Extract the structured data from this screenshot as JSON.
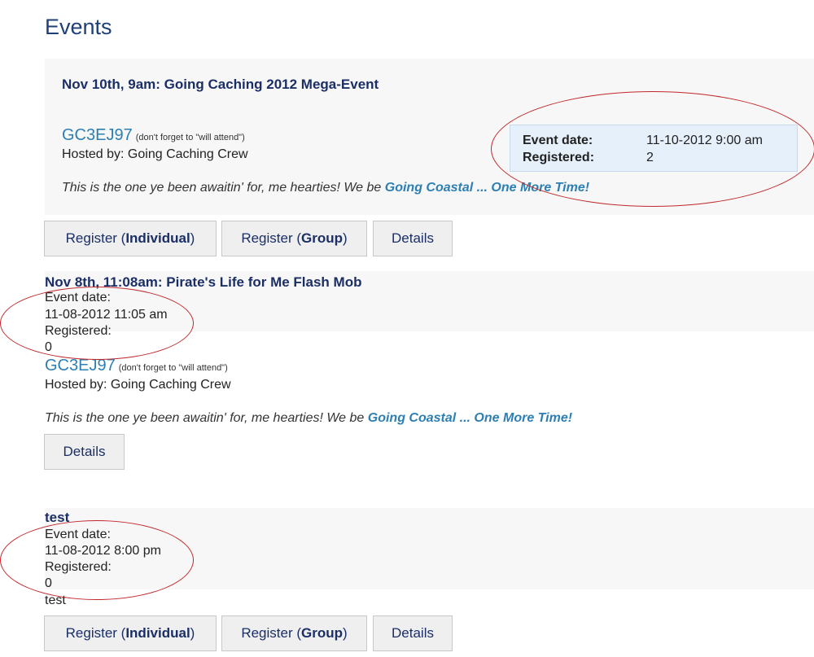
{
  "page": {
    "title": "Events"
  },
  "events": [
    {
      "title": "Nov 10th, 9am: Going Caching 2012 Mega-Event",
      "gc_code": "GC3EJ97",
      "gc_note": "(don't forget to \"will attend\")",
      "hosted_by": "Hosted by: Going Caching Crew",
      "description_prefix": "This is the one ye been awaitin' for, me hearties! We be ",
      "description_link": "Going Coastal ... One More Time!",
      "event_date_label": "Event date:",
      "event_date_value": "11-10-2012 9:00 am",
      "registered_label": "Registered:",
      "registered_value": "2",
      "buttons": {
        "register_individual_prefix": "Register (",
        "register_individual_bold": "Individual",
        "register_individual_suffix": ")",
        "register_group_prefix": "Register (",
        "register_group_bold": "Group",
        "register_group_suffix": ")",
        "details": "Details"
      }
    },
    {
      "title": "Nov 8th, 11:08am: Pirate's Life for Me Flash Mob",
      "event_date_label": "Event date:",
      "event_date_value": "11-08-2012 11:05 am",
      "registered_label": "Registered:",
      "registered_value": "0",
      "gc_code": "GC3EJ97",
      "gc_note": "(don't forget to \"will attend\")",
      "hosted_by": "Hosted by: Going Caching Crew",
      "description_prefix": "This is the one ye been awaitin' for, me hearties! We be ",
      "description_link": "Going Coastal ... One More Time!",
      "buttons": {
        "details": "Details"
      }
    },
    {
      "title": "test",
      "event_date_label": "Event date:",
      "event_date_value": "11-08-2012 8:00 pm",
      "registered_label": "Registered:",
      "registered_value": "0",
      "description": "test",
      "buttons": {
        "register_individual_prefix": "Register (",
        "register_individual_bold": "Individual",
        "register_individual_suffix": ")",
        "register_group_prefix": "Register (",
        "register_group_bold": "Group",
        "register_group_suffix": ")",
        "details": "Details"
      }
    }
  ],
  "colors": {
    "title": "#1f3f78",
    "link": "#2d7fb3",
    "annotation": "#c0282b",
    "info_box_bg": "#e6f0fa"
  }
}
